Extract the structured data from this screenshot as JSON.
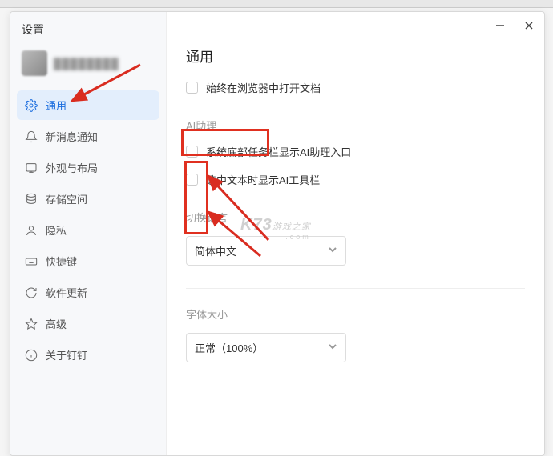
{
  "window": {
    "title": "设置"
  },
  "user": {
    "display_name": "████████"
  },
  "sidebar": {
    "items": [
      {
        "id": "general",
        "label": "通用",
        "icon": "gear-icon",
        "active": true
      },
      {
        "id": "notification",
        "label": "新消息通知",
        "icon": "bell-icon",
        "active": false
      },
      {
        "id": "appearance",
        "label": "外观与布局",
        "icon": "palette-icon",
        "active": false
      },
      {
        "id": "storage",
        "label": "存储空间",
        "icon": "database-icon",
        "active": false
      },
      {
        "id": "privacy",
        "label": "隐私",
        "icon": "person-icon",
        "active": false
      },
      {
        "id": "shortcuts",
        "label": "快捷键",
        "icon": "keyboard-icon",
        "active": false
      },
      {
        "id": "update",
        "label": "软件更新",
        "icon": "refresh-icon",
        "active": false
      },
      {
        "id": "advanced",
        "label": "高级",
        "icon": "star-icon",
        "active": false
      },
      {
        "id": "about",
        "label": "关于钉钉",
        "icon": "info-icon",
        "active": false
      }
    ]
  },
  "main": {
    "page_title": "通用",
    "always_open_in_browser_label": "始终在浏览器中打开文档",
    "ai_section_title": "AI助理",
    "ai_taskbar_label": "系统底部任务栏显示AI助理入口",
    "ai_text_toolbar_label": "选中文本时显示AI工具栏",
    "language_section_title": "切换语言",
    "language_value": "简体中文",
    "font_section_title": "字体大小",
    "font_value": "正常（100%）"
  },
  "watermark": {
    "brand": "K73",
    "sub_top": "游戏之家",
    "sub_bottom": ".com"
  },
  "annotation": {
    "arrow_color": "#d92c20"
  }
}
